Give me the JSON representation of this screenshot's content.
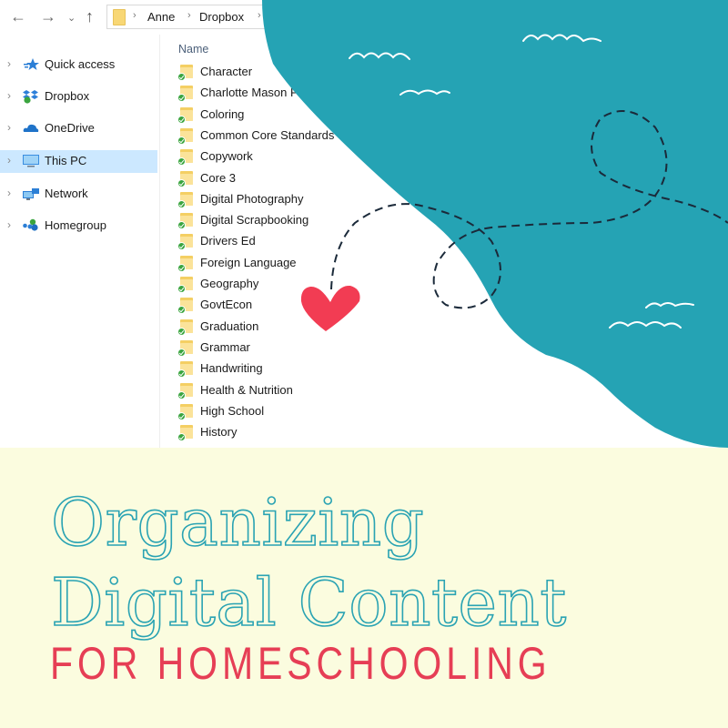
{
  "explorer": {
    "nav": {
      "back_icon": "arrow-left-icon",
      "forward_icon": "arrow-right-icon",
      "recent_icon": "chevron-down-icon",
      "up_icon": "arrow-up-icon",
      "back_glyph": "←",
      "forward_glyph": "→",
      "recent_glyph": "⌄",
      "up_glyph": "↑"
    },
    "breadcrumb": {
      "separator": "›",
      "items": [
        "Anne",
        "Dropbox"
      ]
    },
    "sidebar": {
      "chevron_glyph": "›",
      "items": [
        {
          "label": "Quick access",
          "icon": "star-icon",
          "selected": false
        },
        {
          "label": "Dropbox",
          "icon": "dropbox-icon",
          "selected": false
        },
        {
          "label": "OneDrive",
          "icon": "cloud-icon",
          "selected": false
        },
        {
          "label": "This PC",
          "icon": "computer-icon",
          "selected": true
        },
        {
          "label": "Network",
          "icon": "network-icon",
          "selected": false
        },
        {
          "label": "Homegroup",
          "icon": "homegroup-icon",
          "selected": false
        }
      ]
    },
    "file_list": {
      "column_header": "Name",
      "items": [
        "Character",
        "Charlotte Mason Pr",
        "Coloring",
        "Common Core Standards",
        "Copywork",
        "Core 3",
        "Digital Photography",
        "Digital Scrapbooking",
        "Drivers Ed",
        "Foreign Language",
        "Geography",
        "GovtEcon",
        "Graduation",
        "Grammar",
        "Handwriting",
        "Health & Nutrition",
        "High School",
        "History"
      ]
    }
  },
  "graphic": {
    "blob_color": "#25a3b4",
    "heart_color": "#f23c53",
    "dashed_path_color": "#1b2a3a",
    "wave_color": "#ffffff"
  },
  "banner": {
    "background": "#fbfcdf",
    "title_line1": "Organizing",
    "title_line2": "Digital Content",
    "subtitle": "FOR HOMESCHOOLING",
    "title_color": "#2aa3b3",
    "subtitle_color": "#e63e55"
  }
}
